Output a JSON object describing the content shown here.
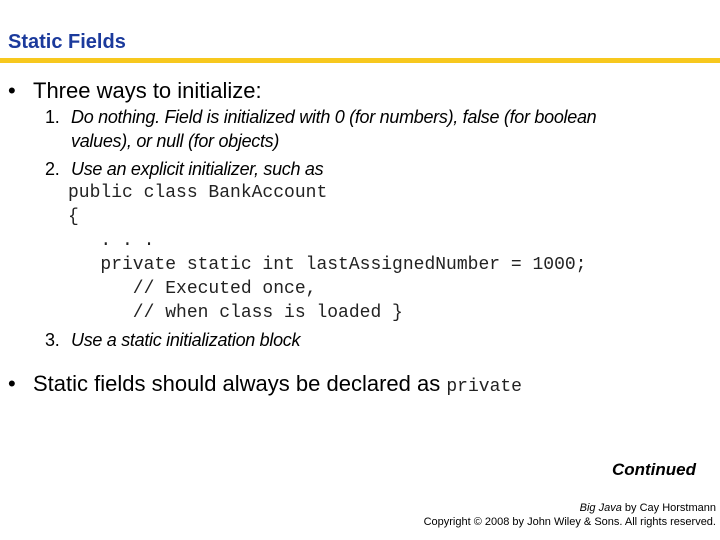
{
  "slide": {
    "title": "Static Fields",
    "bullets": [
      {
        "marker": "•",
        "text": "Three ways to initialize:",
        "items": [
          {
            "number": "1.",
            "line1": "Do nothing. Field is initialized with 0 (for numbers), false (for boolean",
            "line2": "values), or null (for objects)"
          },
          {
            "number": "2.",
            "line1": "Use an explicit initializer, such as",
            "code": [
              "public class BankAccount",
              "{",
              "   . . .",
              "   private static int lastAssignedNumber = 1000;",
              "      // Executed once,",
              "      // when class is loaded }"
            ]
          },
          {
            "number": "3.",
            "line1": "Use a static initialization block"
          }
        ]
      },
      {
        "marker": "•",
        "text": "Static fields should always be declared as",
        "code": "private"
      }
    ],
    "continued": "Continued",
    "credit": {
      "book_title": "Big Java",
      "by_author": " by Cay Horstmann",
      "copyright": "Copyright © 2008 by John Wiley & Sons.  All rights reserved."
    }
  }
}
